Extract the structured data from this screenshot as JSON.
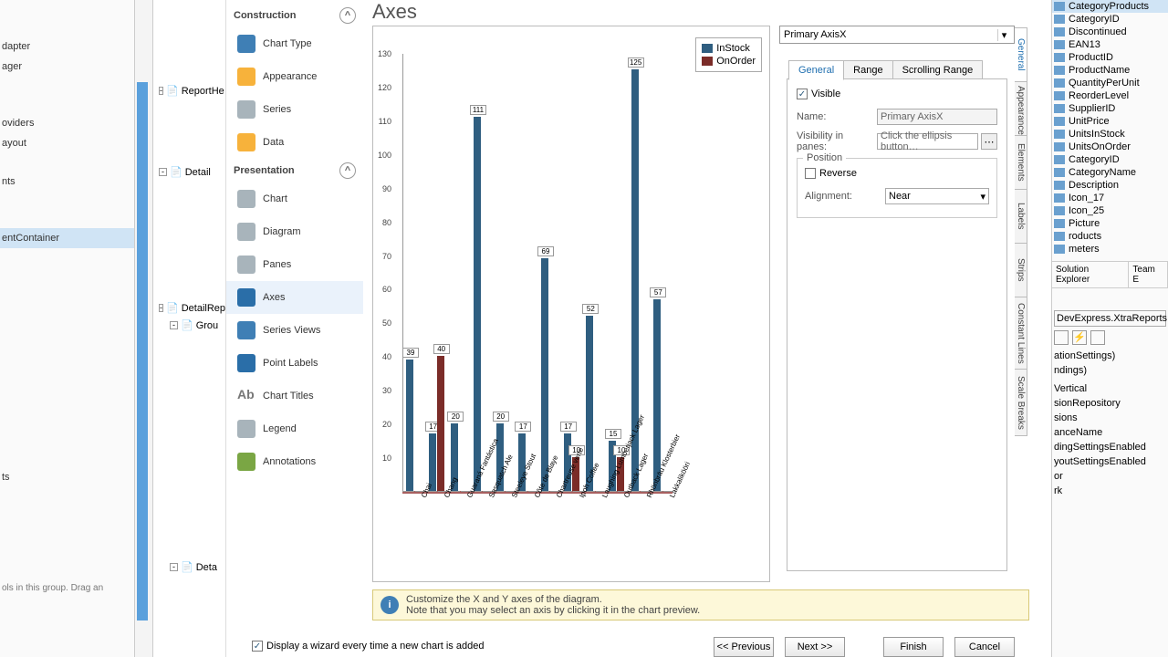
{
  "header": {
    "title": "Axes"
  },
  "left_tree": [
    "dapter",
    "ager",
    "oviders",
    "ayout",
    "nts",
    "entContainer",
    "ts"
  ],
  "left_hint": "ols in this group. Drag an",
  "design_nodes": [
    "ReportHe",
    "Detail",
    "DetailRep",
    "Grou",
    "Deta"
  ],
  "construction": {
    "title": "Construction",
    "items": [
      "Chart Type",
      "Appearance",
      "Series",
      "Data"
    ]
  },
  "presentation": {
    "title": "Presentation",
    "items": [
      "Chart",
      "Diagram",
      "Panes",
      "Axes",
      "Series Views",
      "Point Labels",
      "Chart Titles",
      "Legend",
      "Annotations"
    ],
    "active": "Axes"
  },
  "chart_data": {
    "type": "bar",
    "ylim": [
      0,
      130
    ],
    "yticks": [
      10,
      20,
      30,
      40,
      50,
      60,
      70,
      80,
      90,
      100,
      110,
      120,
      130
    ],
    "legend": [
      "InStock",
      "OnOrder"
    ],
    "categories": [
      "Chai",
      "Chang",
      "Guaraná Fantástica",
      "Sasquatch Ale",
      "Steeleye Stout",
      "Côte de Blaye",
      "Chartreuse verte",
      "Ipoh Coffee",
      "Laughing Lumberjack Lager",
      "Outback Lager",
      "Rhönbräu Klosterbier",
      "Lakkalikööri"
    ],
    "series": [
      {
        "name": "InStock",
        "values": [
          39,
          17,
          20,
          111,
          20,
          17,
          69,
          17,
          52,
          15,
          125,
          57
        ]
      },
      {
        "name": "OnOrder",
        "values": [
          null,
          40,
          null,
          null,
          null,
          null,
          null,
          10,
          null,
          10,
          null,
          null
        ]
      }
    ],
    "labels": [
      [
        39
      ],
      [
        17,
        40
      ],
      [
        20
      ],
      [
        111
      ],
      [
        20
      ],
      [
        17
      ],
      [
        69
      ],
      [
        17,
        10
      ],
      [
        52
      ],
      [
        15,
        10
      ],
      [
        125
      ],
      [
        57
      ]
    ]
  },
  "axis_select": "Primary AxisX",
  "tabs": [
    "General",
    "Range",
    "Scrolling Range"
  ],
  "vtabs": [
    "General",
    "Appearance",
    "Elements",
    "Labels",
    "Strips",
    "Constant Lines",
    "Scale Breaks"
  ],
  "general": {
    "visible": "Visible",
    "name_label": "Name:",
    "name_value": "Primary AxisX",
    "vip_label": "Visibility in panes:",
    "vip_value": "Click the ellipsis button…",
    "position": "Position",
    "reverse": "Reverse",
    "align_label": "Alignment:",
    "align_value": "Near"
  },
  "hint": {
    "line1": "Customize the X and Y axes of the diagram.",
    "line2": "Note that you may select an axis by clicking it in the chart preview."
  },
  "bottom_checkbox": "Display a wizard every time a new chart is added",
  "buttons": {
    "prev": "<< Previous",
    "next": "Next >>",
    "finish": "Finish",
    "cancel": "Cancel"
  },
  "right_tree": [
    "CategoryProducts",
    "CategoryID",
    "Discontinued",
    "EAN13",
    "ProductID",
    "ProductName",
    "QuantityPerUnit",
    "ReorderLevel",
    "SupplierID",
    "UnitPrice",
    "UnitsInStock",
    "UnitsOnOrder",
    "CategoryID",
    "CategoryName",
    "Description",
    "Icon_17",
    "Icon_25",
    "Picture",
    "roducts",
    "meters"
  ],
  "right_tabs": [
    "Solution Explorer",
    "Team E"
  ],
  "right_type": "DevExpress.XtraReports.UI.",
  "right_props": [
    "ationSettings)",
    "ndings)",
    "",
    "Vertical",
    "sionRepository",
    "sions",
    "anceName",
    "dingSettingsEnabled",
    "youtSettingsEnabled",
    "or",
    "rk"
  ]
}
